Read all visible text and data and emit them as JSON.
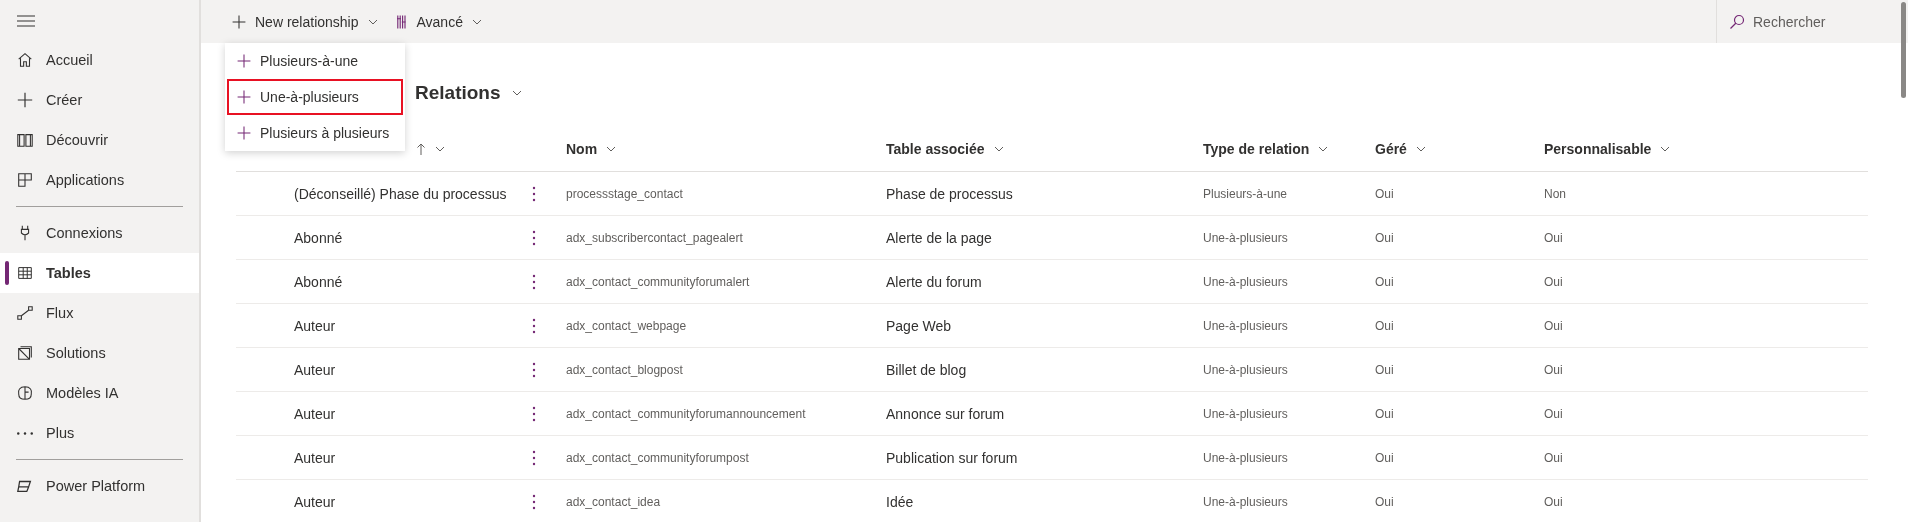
{
  "sidebar": {
    "items": [
      {
        "label": "Accueil",
        "selected": false
      },
      {
        "label": "Créer",
        "selected": false
      },
      {
        "label": "Découvrir",
        "selected": false
      },
      {
        "label": "Applications",
        "selected": false,
        "divider_after": true
      },
      {
        "label": "Connexions",
        "selected": false
      },
      {
        "label": "Tables",
        "selected": true
      },
      {
        "label": "Flux",
        "selected": false
      },
      {
        "label": "Solutions",
        "selected": false
      },
      {
        "label": "Modèles IA",
        "selected": false
      },
      {
        "label": "Plus",
        "selected": false,
        "divider_after": true
      },
      {
        "label": "Power Platform",
        "selected": false
      }
    ]
  },
  "toolbar": {
    "buttons": [
      {
        "label": "New relationship"
      },
      {
        "label": "Avancé"
      }
    ],
    "search": {
      "placeholder": "Rechercher"
    }
  },
  "menu": {
    "items": [
      {
        "label": "Plusieurs-à-une",
        "selected": false
      },
      {
        "label": "Une-à-plusieurs",
        "selected": true
      },
      {
        "label": "Plusieurs à plusieurs",
        "selected": false
      }
    ]
  },
  "heading": "Relations",
  "table": {
    "columns": [
      {
        "sorted": true
      },
      {
        "label": "Nom",
        "sorted": false
      },
      {
        "label": "Table associée",
        "sorted": false
      },
      {
        "label": "Type de relation",
        "sorted": false
      },
      {
        "label": "Géré",
        "sorted": false
      },
      {
        "label": "Personnalisable",
        "sorted": false
      }
    ],
    "rows": [
      [
        "(Déconseillé) Phase du processus",
        "processstage_contact",
        "Phase de processus",
        "Plusieurs-à-une",
        "Oui",
        "Non"
      ],
      [
        "Abonné",
        "adx_subscribercontact_pagealert",
        "Alerte de la page",
        "Une-à-plusieurs",
        "Oui",
        "Oui"
      ],
      [
        "Abonné",
        "adx_contact_communityforumalert",
        "Alerte du forum",
        "Une-à-plusieurs",
        "Oui",
        "Oui"
      ],
      [
        "Auteur",
        "adx_contact_webpage",
        "Page Web",
        "Une-à-plusieurs",
        "Oui",
        "Oui"
      ],
      [
        "Auteur",
        "adx_contact_blogpost",
        "Billet de blog",
        "Une-à-plusieurs",
        "Oui",
        "Oui"
      ],
      [
        "Auteur",
        "adx_contact_communityforumannouncement",
        "Annonce sur forum",
        "Une-à-plusieurs",
        "Oui",
        "Oui"
      ],
      [
        "Auteur",
        "adx_contact_communityforumpost",
        "Publication sur forum",
        "Une-à-plusieurs",
        "Oui",
        "Oui"
      ],
      [
        "Auteur",
        "adx_contact_idea",
        "Idée",
        "Une-à-plusieurs",
        "Oui",
        "Oui"
      ]
    ]
  }
}
